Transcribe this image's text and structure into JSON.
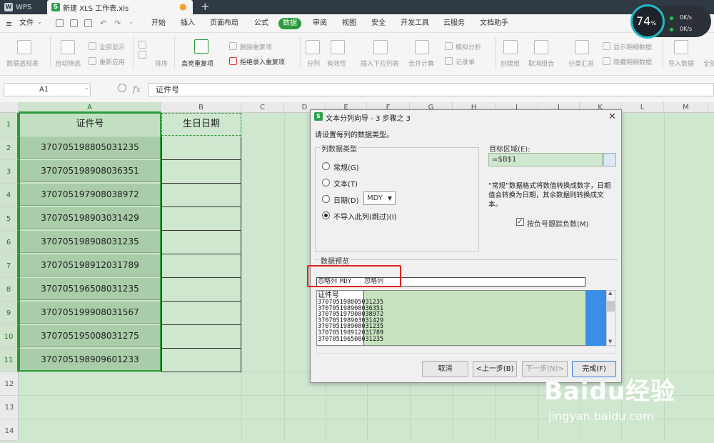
{
  "window": {
    "app_tab": "WPS",
    "doc_tab": "新建 XLS 工作表.xls"
  },
  "menu": {
    "file": "文件",
    "items": [
      "开始",
      "插入",
      "页面布局",
      "公式",
      "数据",
      "审阅",
      "视图",
      "安全",
      "开发工具",
      "云服务",
      "文档助手"
    ],
    "active": "数据"
  },
  "ribbon": {
    "pivot": "数据透视表",
    "autofilter": "自动筛选",
    "show_all": "全部显示",
    "reapply": "重新应用",
    "sort": "排序",
    "highlight_dup": "高亮重复项",
    "delete_dup": "删除重复项",
    "reject_dup": "拒绝录入重复项",
    "split": "分列",
    "validity": "有效性",
    "insert_dropdown": "插入下拉列表",
    "consolidate": "合并计算",
    "simulate": "模拟分析",
    "record": "记录单",
    "create_group": "创建组",
    "ungroup": "取消组合",
    "subtotal": "分类汇总",
    "show_detail": "显示明细数据",
    "hide_detail": "隐藏明细数据",
    "import": "导入数据",
    "all": "全部"
  },
  "formula_bar": {
    "name_box": "A1",
    "fx": "fx",
    "value": "证件号"
  },
  "sheet": {
    "columns": [
      "A",
      "B",
      "C",
      "D",
      "E",
      "F",
      "G",
      "H",
      "I",
      "J",
      "K",
      "L",
      "M"
    ],
    "rows": [
      "1",
      "2",
      "3",
      "4",
      "5",
      "6",
      "7",
      "8",
      "9",
      "10",
      "11",
      "12",
      "13",
      "14"
    ],
    "a1": "证件号",
    "b1": "生日日期",
    "ids": [
      "370705198805031235",
      "370705198908036351",
      "370705197908038972",
      "370705198903031429",
      "370705198908031235",
      "370705198912031789",
      "370705196508031235",
      "370705199908031567",
      "370705195008031275",
      "370705198909601233"
    ]
  },
  "dialog": {
    "title": "文本分列向导 - 3 步骤之 3",
    "close": "✕",
    "prompt": "请设置每列的数据类型。",
    "group_label": "列数据类型",
    "opt_general": "常规(G)",
    "opt_text": "文本(T)",
    "opt_date": "日期(D)",
    "date_format": "MDY",
    "opt_skip": "不导入此列(跳过)(I)",
    "target_label": "目标区域(E):",
    "target_value": "=$B$1",
    "note": "“常规”数据格式将数值转换成数字，日期值会转换为日期，其余数据则转换成文本。",
    "checkbox_label": "按负号跟踪负数(M)",
    "preview_label": "数据预览",
    "preview_headers": [
      "忽略列",
      "MDY",
      "忽略列"
    ],
    "preview_lines": [
      "证件号",
      "370705198805031235",
      "370705198908036351",
      "370705197908038972",
      "370705198903031429",
      "370705198908031235",
      "370705198912031789",
      "370705196508031235"
    ],
    "btn_cancel": "取消",
    "btn_prev": "<上一步(B)",
    "btn_next": "下一步(N)>",
    "btn_finish": "完成(F)"
  },
  "net_widget": {
    "percent": "74",
    "unit": "%",
    "up": "0K/s",
    "down": "0K/s"
  },
  "watermark": {
    "main": "Baidu经验",
    "url": "jingyan.baidu.com"
  },
  "colors": {
    "accent": "#2b9b3a",
    "sheet_bg": "#cfe6cf",
    "highlight_red": "#e02020"
  }
}
